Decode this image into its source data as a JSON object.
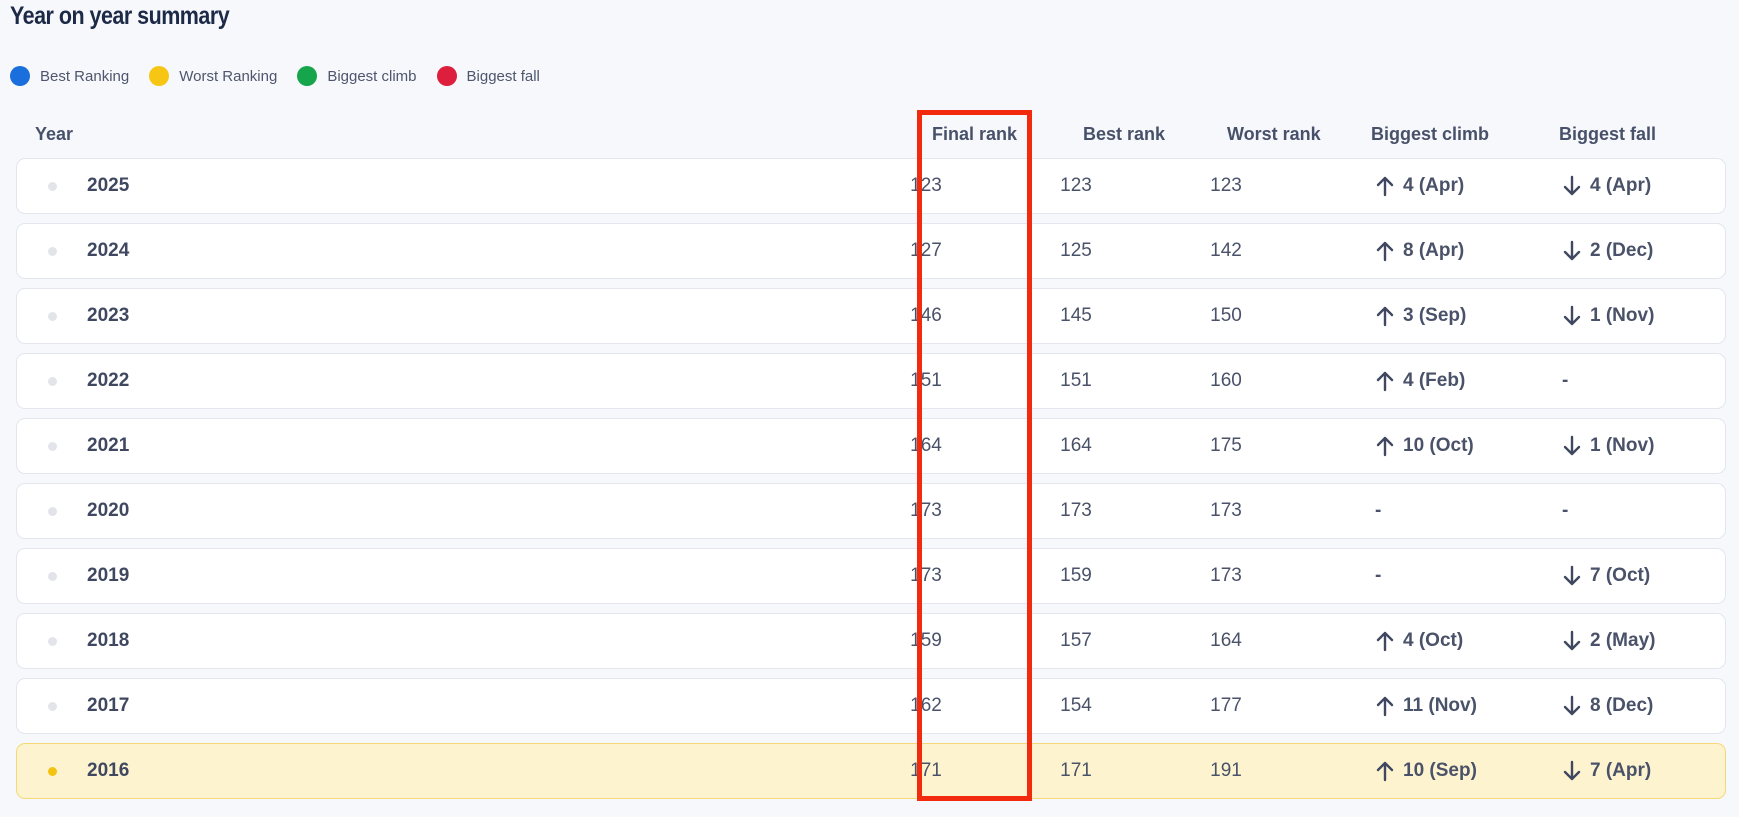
{
  "title": "Year on year summary",
  "legend": [
    {
      "label": "Best Ranking",
      "color": "#1a6fdc"
    },
    {
      "label": "Worst Ranking",
      "color": "#f7c514"
    },
    {
      "label": "Biggest climb",
      "color": "#16a54a"
    },
    {
      "label": "Biggest fall",
      "color": "#dd1f3d"
    }
  ],
  "columns": {
    "year": "Year",
    "final_rank": "Final rank",
    "best_rank": "Best rank",
    "worst_rank": "Worst rank",
    "biggest_climb": "Biggest climb",
    "biggest_fall": "Biggest fall"
  },
  "rows": [
    {
      "year": "2025",
      "final": "123",
      "best": "123",
      "worst": "123",
      "climb": "4 (Apr)",
      "fall": "4 (Apr)"
    },
    {
      "year": "2024",
      "final": "127",
      "best": "125",
      "worst": "142",
      "climb": "8 (Apr)",
      "fall": "2 (Dec)"
    },
    {
      "year": "2023",
      "final": "146",
      "best": "145",
      "worst": "150",
      "climb": "3 (Sep)",
      "fall": "1 (Nov)"
    },
    {
      "year": "2022",
      "final": "151",
      "best": "151",
      "worst": "160",
      "climb": "4 (Feb)",
      "fall": "-"
    },
    {
      "year": "2021",
      "final": "164",
      "best": "164",
      "worst": "175",
      "climb": "10 (Oct)",
      "fall": "1 (Nov)"
    },
    {
      "year": "2020",
      "final": "173",
      "best": "173",
      "worst": "173",
      "climb": "-",
      "fall": "-"
    },
    {
      "year": "2019",
      "final": "173",
      "best": "159",
      "worst": "173",
      "climb": "-",
      "fall": "7 (Oct)"
    },
    {
      "year": "2018",
      "final": "159",
      "best": "157",
      "worst": "164",
      "climb": "4 (Oct)",
      "fall": "2 (May)"
    },
    {
      "year": "2017",
      "final": "162",
      "best": "154",
      "worst": "177",
      "climb": "11 (Nov)",
      "fall": "8 (Dec)"
    },
    {
      "year": "2016",
      "final": "171",
      "best": "171",
      "worst": "191",
      "climb": "10 (Sep)",
      "fall": "7 (Apr)",
      "highlighted": true
    }
  ],
  "colors": {
    "highlight_row": "#fdf4cf",
    "highlight_dot": "#f4c210",
    "annotation_box": "#f32b0e"
  },
  "icons": {
    "climb": "arrow-up-icon",
    "fall": "arrow-down-icon"
  }
}
